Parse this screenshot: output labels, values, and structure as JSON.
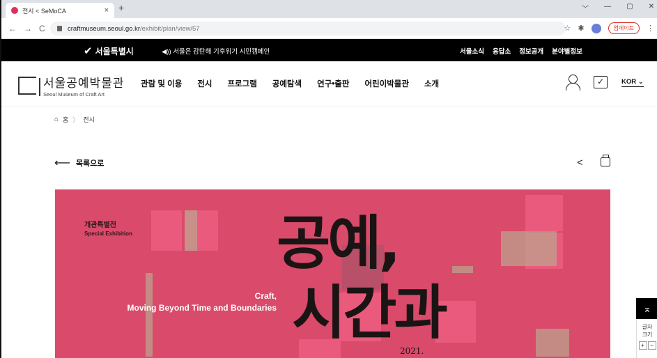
{
  "browser": {
    "tab_title": "전시 < SeMoCA",
    "tab_close": "×",
    "new_tab": "+",
    "win_min": "﹀",
    "win_dash": "—",
    "win_max": "▢",
    "win_close": "✕",
    "back": "←",
    "forward": "→",
    "reload": "C",
    "url_host": "craftmuseum.seoul.go.kr",
    "url_path": "/exhibit/plan/view/57",
    "star": "☆",
    "extension": "✱",
    "update_label": "업데이트",
    "menu": "⋮"
  },
  "seoul_bar": {
    "logo_mark": "✔",
    "logo_text": "서울특별시",
    "campaign_text": "◀)) 서울은 감탄해 기후위기 시민캠페인",
    "links": [
      "서울소식",
      "응답소",
      "정보공개",
      "분야별정보"
    ]
  },
  "header": {
    "logo_ko": "서울공예박물관",
    "logo_en": "Seoul Museum of Craft Art",
    "nav": [
      "관람 및 이용",
      "전시",
      "프로그램",
      "공예탐색",
      "연구•출판",
      "어린이박물관",
      "소개"
    ],
    "check_glyph": "✓",
    "lang": "KOR ⌄"
  },
  "breadcrumb": {
    "home_icon": "⌂",
    "home": "홈",
    "sep": "〉",
    "current": "전시"
  },
  "back": {
    "arrow": "⟵",
    "label": "목록으로"
  },
  "share_glyph": "<",
  "poster": {
    "badge_ko": "개관특별전",
    "badge_en": "Special Exhibition",
    "title_line1": "공예,",
    "title_line2": "시간과",
    "subtitle_1": "Craft,",
    "subtitle_2": "Moving Beyond Time and Boundaries",
    "year": "2021."
  },
  "float_widget": {
    "to_top": "⌅",
    "font_label_1": "글자",
    "font_label_2": "크기",
    "plus": "+",
    "minus": "−"
  },
  "colors": {
    "poster_bg": "#d94a6b",
    "poster_square": "#ea5a7d",
    "brand_dark": "#000000"
  }
}
